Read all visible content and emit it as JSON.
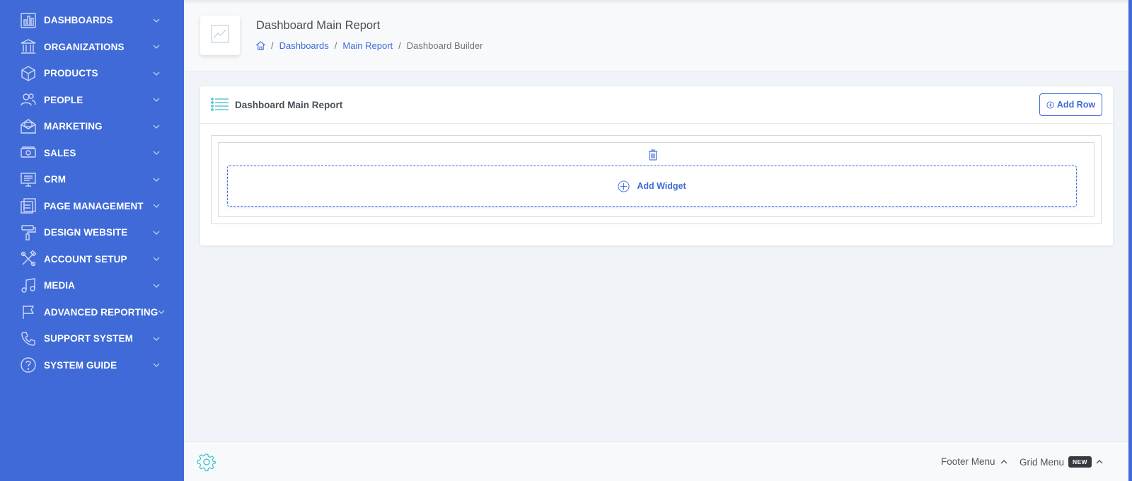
{
  "sidebar": {
    "items": [
      {
        "label": "DASHBOARDS",
        "icon": "bar-chart-icon"
      },
      {
        "label": "ORGANIZATIONS",
        "icon": "bank-icon"
      },
      {
        "label": "PRODUCTS",
        "icon": "box-icon"
      },
      {
        "label": "PEOPLE",
        "icon": "users-icon"
      },
      {
        "label": "MARKETING",
        "icon": "mail-open-icon"
      },
      {
        "label": "SALES",
        "icon": "cash-icon"
      },
      {
        "label": "CRM",
        "icon": "monitor-icon"
      },
      {
        "label": "PAGE MANAGEMENT",
        "icon": "pages-icon"
      },
      {
        "label": "DESIGN WEBSITE",
        "icon": "paint-roller-icon"
      },
      {
        "label": "ACCOUNT SETUP",
        "icon": "tools-icon"
      },
      {
        "label": "MEDIA",
        "icon": "music-note-icon"
      },
      {
        "label": "ADVANCED REPORTING",
        "icon": "flag-icon"
      },
      {
        "label": "SUPPORT SYSTEM",
        "icon": "phone-icon"
      },
      {
        "label": "SYSTEM GUIDE",
        "icon": "help-circle-icon"
      }
    ]
  },
  "header": {
    "title": "Dashboard Main Report",
    "breadcrumb": {
      "items": [
        "Dashboards",
        "Main Report"
      ],
      "current": "Dashboard Builder",
      "separator": "/"
    }
  },
  "card": {
    "title": "Dashboard Main Report",
    "add_row_label": "Add Row",
    "add_widget_label": "Add Widget"
  },
  "footer": {
    "footer_menu_label": "Footer Menu",
    "grid_menu_label": "Grid Menu",
    "grid_menu_badge": "NEW"
  },
  "colors": {
    "primary": "#3f6ad8",
    "sidebar_bg": "#3f6ad8",
    "page_bg": "#f0f3f7",
    "accent_teal": "#3ac1c8"
  }
}
